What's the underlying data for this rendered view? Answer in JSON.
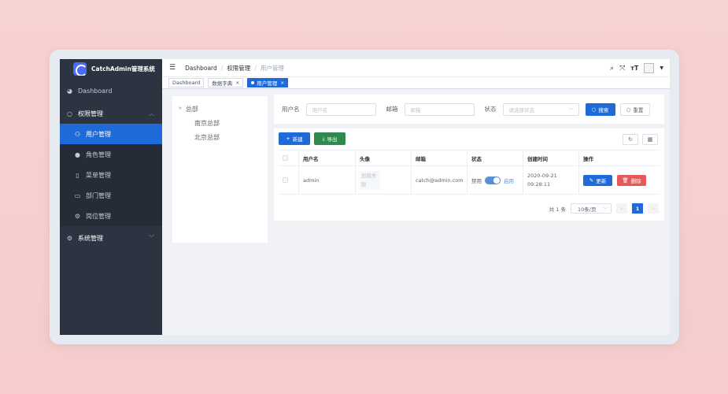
{
  "app": {
    "title": "CatchAdmin管理系统"
  },
  "sidebar": {
    "items": [
      {
        "label": "Dashboard",
        "icon": "dashboard-icon"
      },
      {
        "label": "权限管理",
        "icon": "lock-icon"
      },
      {
        "label": "用户管理",
        "icon": "user-icon"
      },
      {
        "label": "角色管理",
        "icon": "role-icon"
      },
      {
        "label": "菜单管理",
        "icon": "bookmark-icon"
      },
      {
        "label": "部门管理",
        "icon": "monitor-icon"
      },
      {
        "label": "岗位管理",
        "icon": "settings-icon"
      },
      {
        "label": "系统管理",
        "icon": "gear-icon"
      }
    ]
  },
  "breadcrumb": {
    "items": [
      "Dashboard",
      "权限管理",
      "用户管理"
    ],
    "sep": "/"
  },
  "tags": {
    "items": [
      "Dashboard",
      "数据字典",
      "用户管理"
    ]
  },
  "tree": {
    "root": "总部",
    "children": [
      "南京总部",
      "北京总部"
    ]
  },
  "search": {
    "username_label": "用户名",
    "username_placeholder": "用户名",
    "email_label": "邮箱",
    "email_placeholder": "邮箱",
    "status_label": "状态",
    "status_placeholder": "请选择状态",
    "search_button": "搜索",
    "reset_button": "重置"
  },
  "toolbar": {
    "new_button": "新建",
    "export_button": "导出"
  },
  "table": {
    "headers": [
      "用户名",
      "头像",
      "邮箱",
      "状态",
      "创建时间",
      "操作"
    ],
    "rows": [
      {
        "username": "admin",
        "avatar_fail_text": "加载失败",
        "email": "catch@admin.com",
        "status_off": "禁用",
        "status_on": "启用",
        "created": "2020-09-21 09:28:11",
        "update": "更新",
        "delete": "删除"
      }
    ]
  },
  "pagination": {
    "total": "共 1 条",
    "page_size": "10条/页",
    "current": "1"
  },
  "colors": {
    "primary": "#1e6ad8",
    "sidebar": "#2c3441",
    "success": "#2f8a4e",
    "danger": "#e45a5a"
  }
}
